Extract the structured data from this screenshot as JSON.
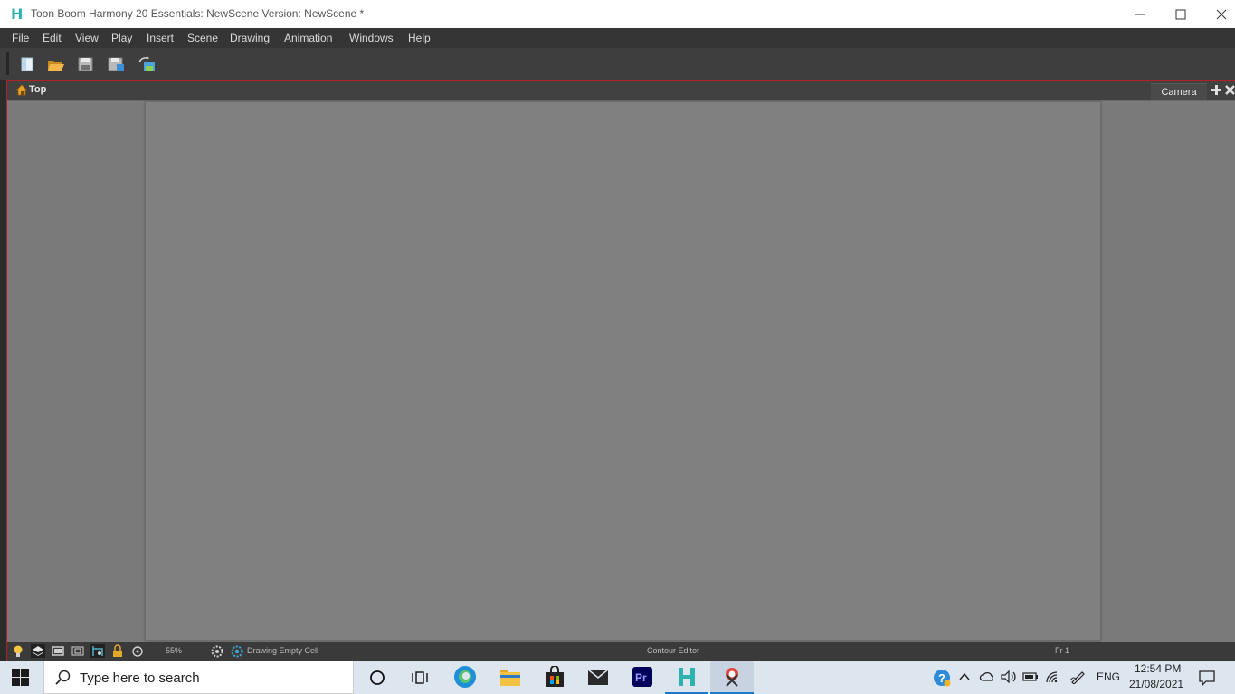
{
  "window": {
    "title": "Toon Boom Harmony 20 Essentials: NewScene Version: NewScene *",
    "logo": "H"
  },
  "menu": [
    "File",
    "Edit",
    "View",
    "Play",
    "Insert",
    "Scene",
    "Drawing",
    "Animation",
    "Windows",
    "Help"
  ],
  "toolbar": {
    "buttons": [
      "new-scene-icon",
      "open-scene-icon",
      "save-icon",
      "save-as-icon",
      "import-icon"
    ]
  },
  "panel": {
    "breadcrumb": "Top",
    "tab": "Camera"
  },
  "status": {
    "zoom": "55%",
    "drawing": "Drawing Empty Cell",
    "editor": "Contour Editor",
    "frame": "Fr 1"
  },
  "taskbar": {
    "search_placeholder": "Type here to search",
    "language": "ENG",
    "time": "12:54 PM",
    "date": "21/08/2021"
  },
  "colors": {
    "accent_red": "#b32020",
    "harmony_teal": "#2cb3b0"
  }
}
